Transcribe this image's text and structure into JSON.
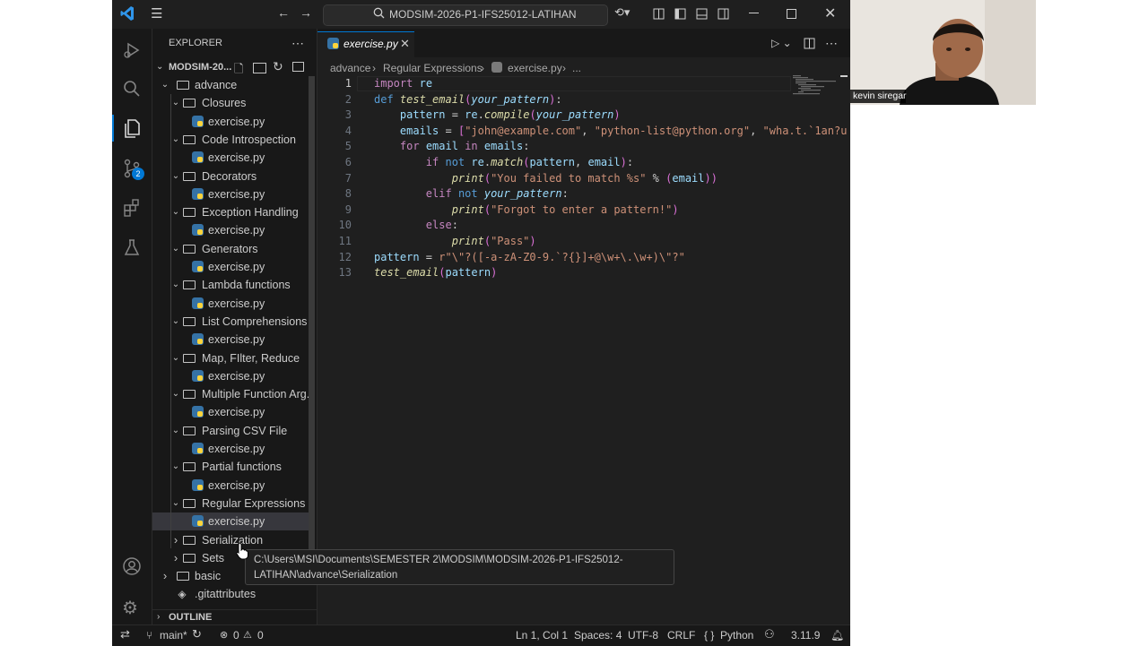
{
  "titlebar": {
    "search_text": "MODSIM-2026-P1-IFS25012-LATIHAN",
    "icons": [
      "vscode-logo-icon",
      "menu-icon",
      "back-arrow-icon",
      "forward-arrow-icon",
      "search-icon",
      "copilot-icon",
      "layout-icon",
      "toggle-sidebar-icon",
      "toggle-panel-icon",
      "toggle-secondary-sidebar-icon",
      "minimize-icon",
      "maximize-icon",
      "close-icon"
    ]
  },
  "activitybar": {
    "items": [
      "explorer-icon",
      "search-icon",
      "source-control-icon",
      "extensions-icon",
      "testing-icon",
      "run-debug-icon"
    ],
    "source_control_badge": "2"
  },
  "sidebar": {
    "header": "EXPLORER",
    "workspace": "MODSIM-20...",
    "tree": [
      {
        "type": "folder",
        "label": "advance",
        "level": 0,
        "open": true
      },
      {
        "type": "folder",
        "label": "Closures",
        "level": 1,
        "open": true
      },
      {
        "type": "file",
        "label": "exercise.py",
        "level": 2
      },
      {
        "type": "folder",
        "label": "Code Introspection",
        "level": 1,
        "open": true
      },
      {
        "type": "file",
        "label": "exercise.py",
        "level": 2
      },
      {
        "type": "folder",
        "label": "Decorators",
        "level": 1,
        "open": true
      },
      {
        "type": "file",
        "label": "exercise.py",
        "level": 2
      },
      {
        "type": "folder",
        "label": "Exception Handling",
        "level": 1,
        "open": true
      },
      {
        "type": "file",
        "label": "exercise.py",
        "level": 2
      },
      {
        "type": "folder",
        "label": "Generators",
        "level": 1,
        "open": true
      },
      {
        "type": "file",
        "label": "exercise.py",
        "level": 2
      },
      {
        "type": "folder",
        "label": "Lambda functions",
        "level": 1,
        "open": true
      },
      {
        "type": "file",
        "label": "exercise.py",
        "level": 2
      },
      {
        "type": "folder",
        "label": "List Comprehensions",
        "level": 1,
        "open": true
      },
      {
        "type": "file",
        "label": "exercise.py",
        "level": 2
      },
      {
        "type": "folder",
        "label": "Map, FIlter, Reduce",
        "level": 1,
        "open": true
      },
      {
        "type": "file",
        "label": "exercise.py",
        "level": 2
      },
      {
        "type": "folder",
        "label": "Multiple Function Arg...",
        "level": 1,
        "open": true
      },
      {
        "type": "file",
        "label": "exercise.py",
        "level": 2
      },
      {
        "type": "folder",
        "label": "Parsing CSV File",
        "level": 1,
        "open": true
      },
      {
        "type": "file",
        "label": "exercise.py",
        "level": 2
      },
      {
        "type": "folder",
        "label": "Partial functions",
        "level": 1,
        "open": true
      },
      {
        "type": "file",
        "label": "exercise.py",
        "level": 2
      },
      {
        "type": "folder",
        "label": "Regular Expressions",
        "level": 1,
        "open": true
      },
      {
        "type": "file",
        "label": "exercise.py",
        "level": 2,
        "selected": true
      },
      {
        "type": "folder",
        "label": "Serialization",
        "level": 1,
        "open": false
      },
      {
        "type": "folder",
        "label": "Sets",
        "level": 1,
        "open": false
      },
      {
        "type": "folder",
        "label": "basic",
        "level": 0,
        "open": false
      },
      {
        "type": "gitfile",
        "label": ".gitattributes",
        "level": 0
      }
    ],
    "outline_label": "OUTLINE"
  },
  "editor": {
    "tab_label": "exercise.py",
    "breadcrumb": [
      "advance",
      "Regular Expressions",
      "exercise.py",
      "..."
    ],
    "line_numbers": [
      "1",
      "2",
      "3",
      "4",
      "5",
      "6",
      "7",
      "8",
      "9",
      "10",
      "11",
      "12",
      "13"
    ],
    "lines": [
      "import re",
      "def test_email(your_pattern):",
      "    pattern = re.compile(your_pattern)",
      "    emails = [\"john@example.com\", \"python-list@python.org\", \"wha.t.`1an?u",
      "    for email in emails:",
      "        if not re.match(pattern, email):",
      "            print(\"You failed to match %s\" % (email))",
      "        elif not your_pattern:",
      "            print(\"Forgot to enter a pattern!\")",
      "        else:",
      "            print(\"Pass\")",
      "pattern = r\"\\\"?([-a-zA-Z0-9.`?{}]+@\\w+\\.\\w+)\\\"?\"",
      "test_email(pattern)"
    ]
  },
  "tooltip": {
    "text": "C:\\Users\\MSI\\Documents\\SEMESTER 2\\MODSIM\\MODSIM-2026-P1-IFS25012-LATIHAN\\advance\\Serialization"
  },
  "statusbar": {
    "branch": "main*",
    "errors": "0",
    "warnings": "0",
    "position": "Ln 1, Col 1",
    "spaces": "Spaces: 4",
    "encoding": "UTF-8",
    "eol": "CRLF",
    "language": "Python",
    "python_version": "3.11.9"
  },
  "webcam": {
    "name": "kevin siregar"
  }
}
